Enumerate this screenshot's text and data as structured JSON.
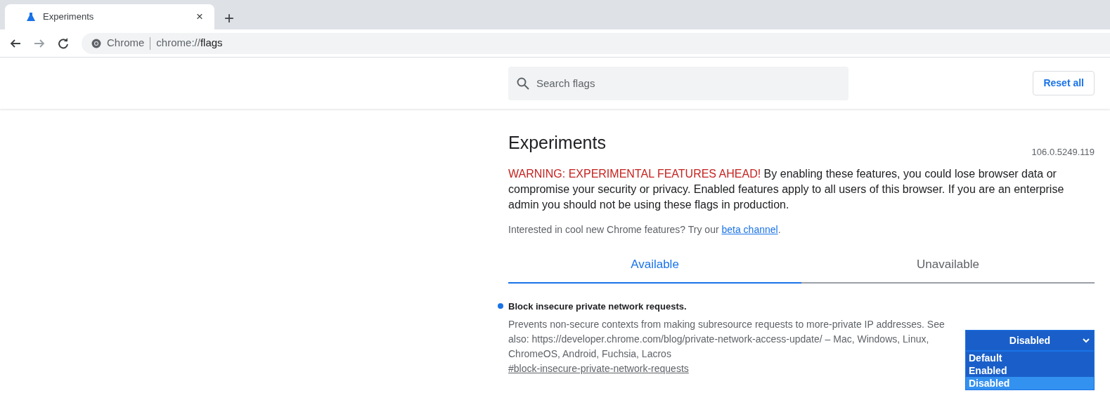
{
  "browser": {
    "tabs": [
      {
        "title": "Experiments",
        "selected": true
      }
    ],
    "new_tab": "+",
    "close": "×",
    "address": {
      "site": "Chrome",
      "url_prefix": "chrome://",
      "url_path": "flags"
    }
  },
  "search": {
    "placeholder": "Search flags"
  },
  "reset_button": "Reset all",
  "title": "Experiments",
  "version": "106.0.5249.119",
  "warning": {
    "label": "WARNING: EXPERIMENTAL FEATURES AHEAD!",
    "text": "By enabling these features, you could lose browser data or compromise your security or privacy. Enabled features apply to all users of this browser. If you are an enterprise admin you should not be using these flags in production."
  },
  "promo": {
    "text": "Interested in cool new Chrome features? Try our",
    "link": "beta channel",
    "after": "."
  },
  "tabs": [
    {
      "label": "Available",
      "selected": true
    },
    {
      "label": "Unavailable",
      "selected": false
    }
  ],
  "flags": [
    {
      "title": "Block insecure private network requests.",
      "modified": true,
      "description": "Prevents non-secure contexts from making subresource requests to more-private IP addresses. See also: https://developer.chrome.com/blog/private-network-access-update/ – Mac, Windows, Linux, ChromeOS, Android, Fuchsia, Lacros",
      "anchor": "#block-insecure-private-network-requests",
      "select": {
        "value": "Disabled",
        "expanded": true,
        "options": [
          {
            "label": "Default",
            "selected": false
          },
          {
            "label": "Enabled",
            "selected": false
          },
          {
            "label": "Disabled",
            "selected": true
          }
        ]
      }
    }
  ]
}
